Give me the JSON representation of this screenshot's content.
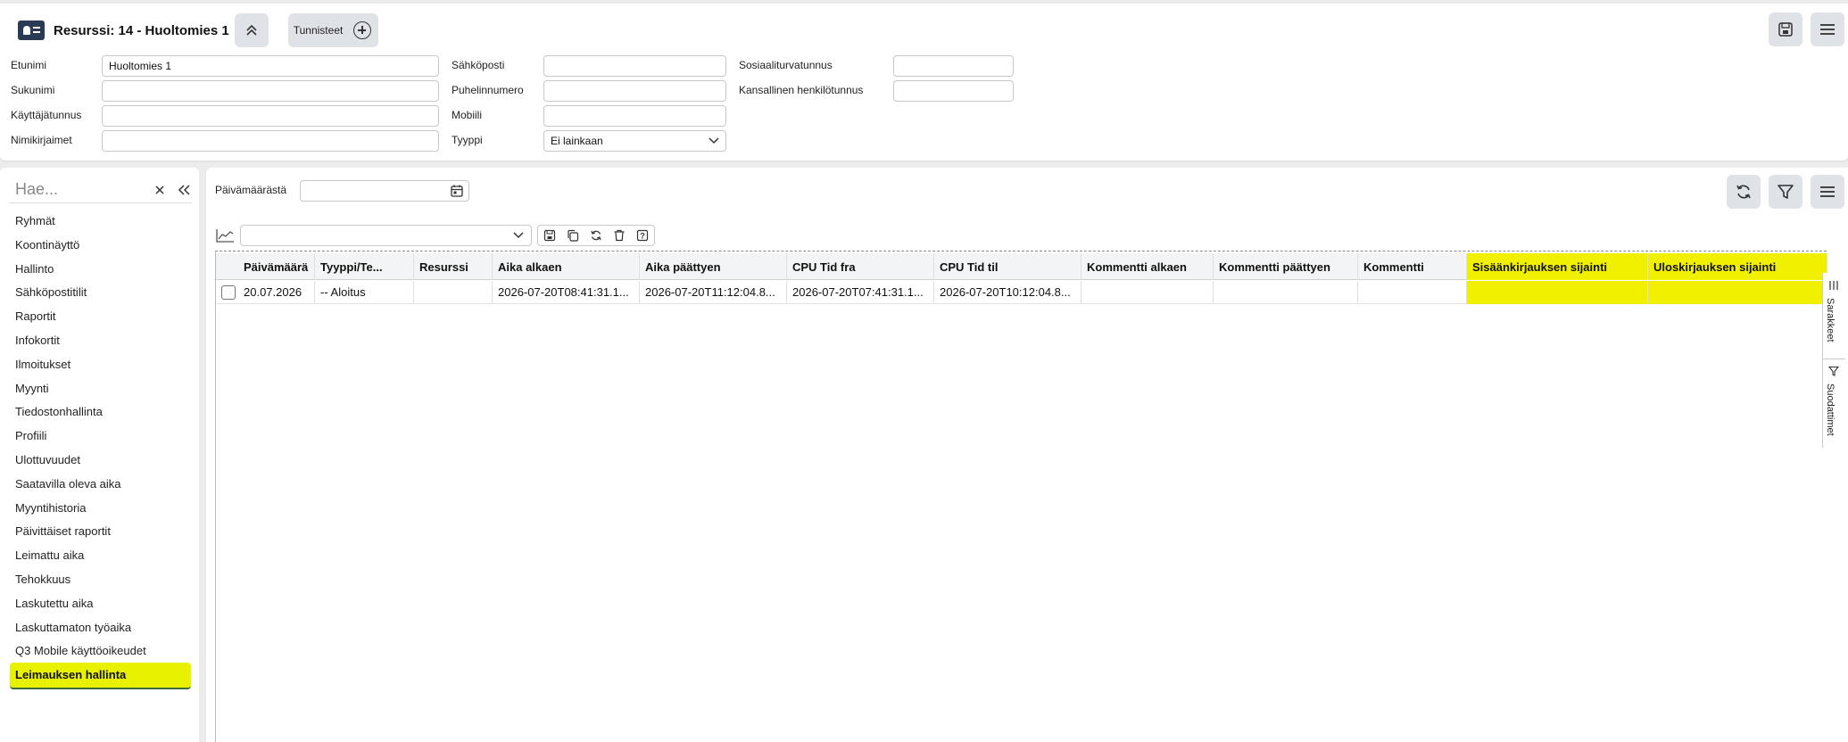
{
  "header": {
    "title": "Resurssi: 14 - Huoltomies 1",
    "tags_label": "Tunnisteet"
  },
  "form": {
    "etunimi_label": "Etunimi",
    "etunimi_value": "Huoltomies 1",
    "sukunimi_label": "Sukunimi",
    "sukunimi_value": "",
    "kayttajatunnus_label": "Käyttäjätunnus",
    "kayttajatunnus_value": "",
    "nimikirjaimet_label": "Nimikirjaimet",
    "nimikirjaimet_value": "",
    "sahkoposti_label": "Sähköposti",
    "sahkoposti_value": "",
    "puhelinnumero_label": "Puhelinnumero",
    "puhelinnumero_value": "",
    "mobiili_label": "Mobiili",
    "mobiili_value": "",
    "tyyppi_label": "Tyyppi",
    "tyyppi_value": "Ei lainkaan",
    "sosiaaliturvatunnus_label": "Sosiaaliturvatunnus",
    "sosiaaliturvatunnus_value": "",
    "kansallinen_label": "Kansallinen henkilötunnus",
    "kansallinen_value": ""
  },
  "sidebar": {
    "search_placeholder": "Hae...",
    "items": [
      {
        "label": "Ryhmät"
      },
      {
        "label": "Koontinäyttö"
      },
      {
        "label": "Hallinto"
      },
      {
        "label": "Sähköpostitilit"
      },
      {
        "label": "Raportit"
      },
      {
        "label": "Infokortit"
      },
      {
        "label": "Ilmoitukset"
      },
      {
        "label": "Myynti"
      },
      {
        "label": "Tiedostonhallinta"
      },
      {
        "label": "Profiili"
      },
      {
        "label": "Ulottuvuudet"
      },
      {
        "label": "Saatavilla oleva aika"
      },
      {
        "label": "Myyntihistoria"
      },
      {
        "label": "Päivittäiset raportit"
      },
      {
        "label": "Leimattu aika"
      },
      {
        "label": "Tehokkuus"
      },
      {
        "label": "Laskutettu aika"
      },
      {
        "label": "Laskuttamaton työaika"
      },
      {
        "label": "Q3 Mobile käyttöoikeudet"
      },
      {
        "label": "Leimauksen hallinta"
      }
    ],
    "active_index": 19
  },
  "main": {
    "date_label": "Päivämäärästä",
    "date_value": "",
    "view_select_value": "",
    "side_tabs": [
      "Sarakkeet",
      "Suodattimet"
    ]
  },
  "table": {
    "columns": [
      {
        "label": "Päivämäärä"
      },
      {
        "label": "Tyyppi/Te..."
      },
      {
        "label": "Resurssi"
      },
      {
        "label": "Aika alkaen"
      },
      {
        "label": "Aika päättyen"
      },
      {
        "label": "CPU Tid fra"
      },
      {
        "label": "CPU Tid til"
      },
      {
        "label": "Kommentti alkaen"
      },
      {
        "label": "Kommentti päättyen"
      },
      {
        "label": "Kommentti"
      },
      {
        "label": "Sisäänkirjauksen sijainti"
      },
      {
        "label": "Uloskirjauksen sijainti"
      }
    ],
    "rows": [
      {
        "cells": [
          "20.07.2026",
          "-- Aloitus",
          "",
          "2026-07-20T08:41:31.1...",
          "2026-07-20T11:12:04.8...",
          "2026-07-20T07:41:31.1...",
          "2026-07-20T10:12:04.8...",
          "",
          "",
          "",
          "",
          ""
        ]
      }
    ]
  },
  "colors": {
    "highlight": "#f0f000",
    "active_item": "#e8f200"
  }
}
